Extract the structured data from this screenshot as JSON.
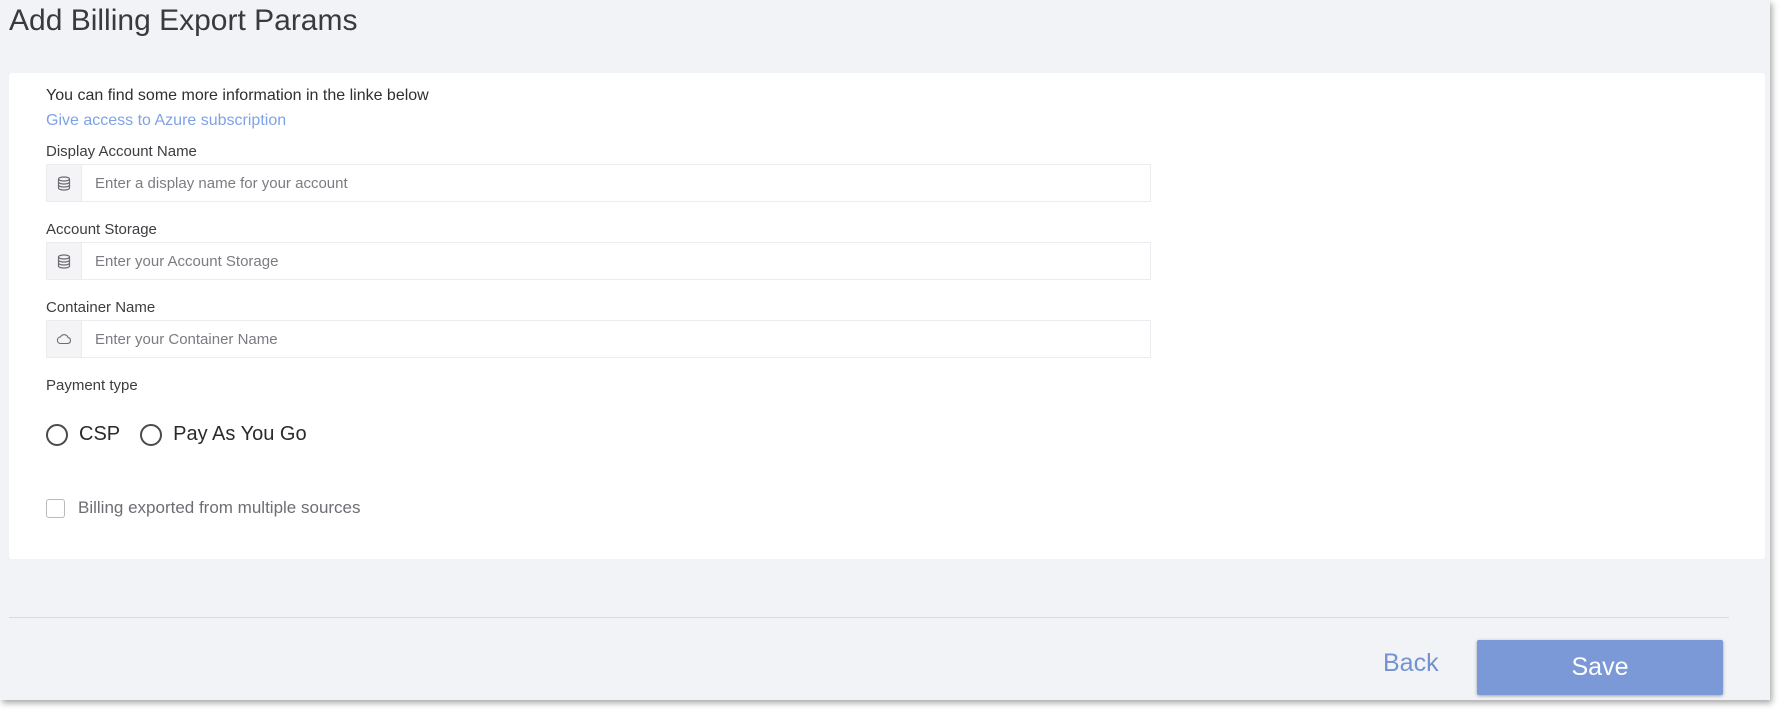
{
  "page": {
    "title": "Add Billing Export Params"
  },
  "info": {
    "text": "You can find some more information in the linke below",
    "link_label": "Give access to Azure subscription"
  },
  "fields": {
    "display_account_name": {
      "label": "Display Account Name",
      "placeholder": "Enter a display name for your account",
      "value": "",
      "icon": "database-icon"
    },
    "account_storage": {
      "label": "Account Storage",
      "placeholder": "Enter your Account Storage",
      "value": "",
      "icon": "database-icon"
    },
    "container_name": {
      "label": "Container Name",
      "placeholder": "Enter your Container Name",
      "value": "",
      "icon": "cloud-icon"
    }
  },
  "payment": {
    "label": "Payment type",
    "options": [
      {
        "label": "CSP",
        "selected": false
      },
      {
        "label": "Pay As You Go",
        "selected": false
      }
    ]
  },
  "multiple_sources": {
    "label": "Billing exported from multiple sources",
    "checked": false
  },
  "footer": {
    "back_label": "Back",
    "save_label": "Save"
  },
  "colors": {
    "background": "#f2f3f7",
    "card": "#ffffff",
    "link": "#7fa2e6",
    "primary_button": "#7b98d7",
    "back_text": "#7393d0"
  }
}
